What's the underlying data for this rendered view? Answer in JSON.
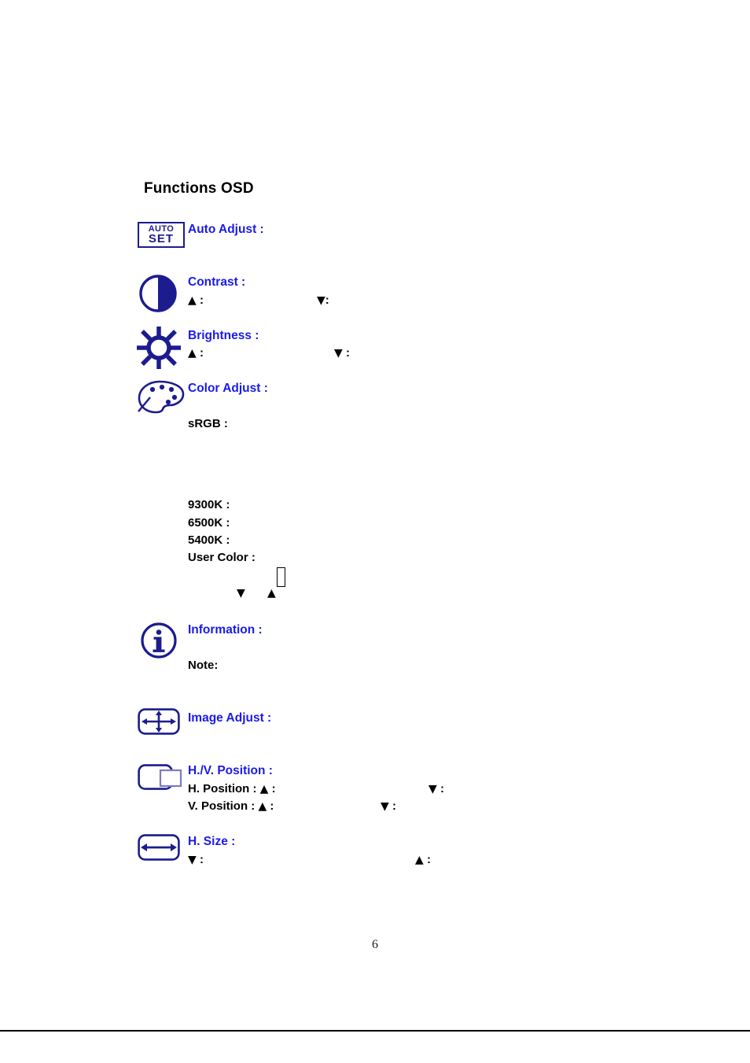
{
  "document": {
    "title": "Functions OSD",
    "page_number": "6"
  },
  "sections": [
    {
      "id": "auto-adjust",
      "icon": "auto-set-icon",
      "icon_text_line1": "AUTO",
      "icon_text_line2": "SET",
      "label": "Auto Adjust :"
    },
    {
      "id": "contrast",
      "icon": "contrast-icon",
      "label": "Contrast :",
      "up_marker": "▲",
      "up_colon": ":",
      "down_marker": "▼",
      "down_colon": ":"
    },
    {
      "id": "brightness",
      "icon": "brightness-icon",
      "label": "Brightness :",
      "up_marker": "▲",
      "up_colon": ":",
      "down_marker": "▼",
      "down_colon": ":"
    },
    {
      "id": "color-adjust",
      "icon": "color-palette-icon",
      "label": "Color Adjust :",
      "srgb_label": "sRGB :",
      "presets": [
        "9300K :",
        "6500K :",
        "5400K :",
        "User Color :"
      ],
      "user_color_box": "",
      "down_marker": "▼",
      "up_marker": "▲"
    },
    {
      "id": "information",
      "icon": "information-icon",
      "label": "Information :",
      "note_label": "Note:"
    },
    {
      "id": "image-adjust",
      "icon": "image-adjust-icon",
      "label": "Image Adjust :"
    },
    {
      "id": "hv-position",
      "icon": "hv-position-icon",
      "label": "H./V. Position :",
      "h_position_label": "H. Position :",
      "h_up_marker": "▲",
      "h_up_colon": ":",
      "h_down_marker": "▼",
      "h_down_colon": ":",
      "v_position_label": "V. Position :",
      "v_up_marker": "▲",
      "v_up_colon": ":",
      "v_down_marker": "▼",
      "v_down_colon": ":"
    },
    {
      "id": "h-size",
      "icon": "h-size-icon",
      "label": "H. Size :",
      "down_marker": "▼",
      "down_colon": ":",
      "up_marker": "▲",
      "up_colon": ":"
    }
  ],
  "colors": {
    "label_blue": "#1a1aea",
    "icon_navy": "#1c1c8f",
    "text_black": "#000000"
  }
}
